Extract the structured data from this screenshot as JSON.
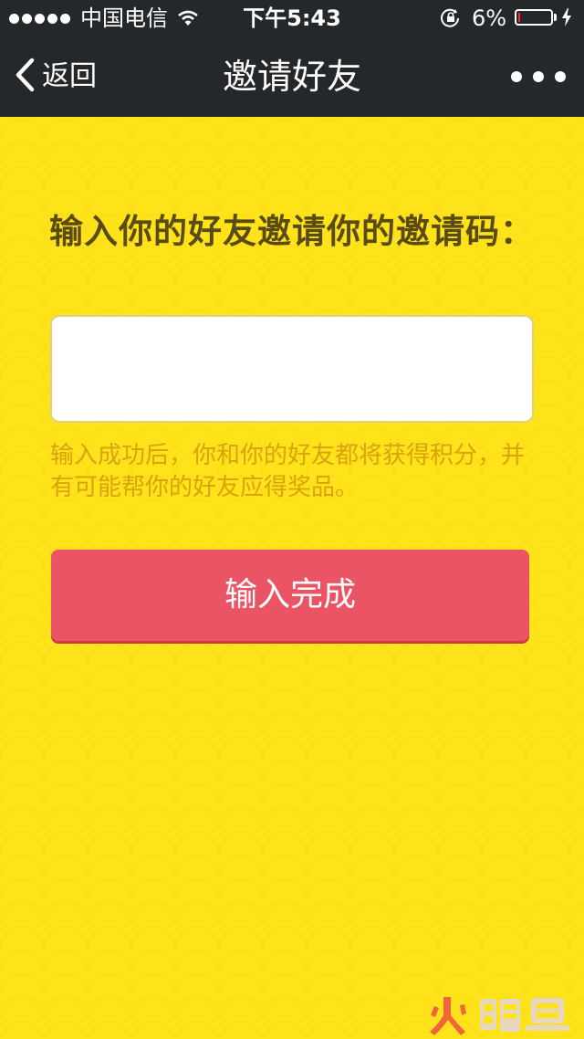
{
  "status_bar": {
    "carrier": "中国电信",
    "time": "下午5:43",
    "battery": "6%",
    "battery_level": 0.06
  },
  "nav": {
    "back_label": "返回",
    "title": "邀请好友"
  },
  "main": {
    "heading": "输入你的好友邀请你的邀请码：",
    "code_input": {
      "value": "",
      "placeholder": ""
    },
    "hint": "输入成功后，你和你的好友都将获得积分，并有可能帮你的好友应得奖品。",
    "submit_label": "输入完成"
  },
  "watermark": {
    "text": "火鲤鱼"
  },
  "colors": {
    "nav_bg": "#25282b",
    "page_bg": "#ffe31a",
    "heading": "#5a4a14",
    "hint": "#d9a20e",
    "button": "#eb5465"
  },
  "icons": [
    "signal-dots-icon",
    "wifi-icon",
    "orientation-lock-icon",
    "battery-icon",
    "charging-icon",
    "chevron-left-icon",
    "more-icon"
  ]
}
